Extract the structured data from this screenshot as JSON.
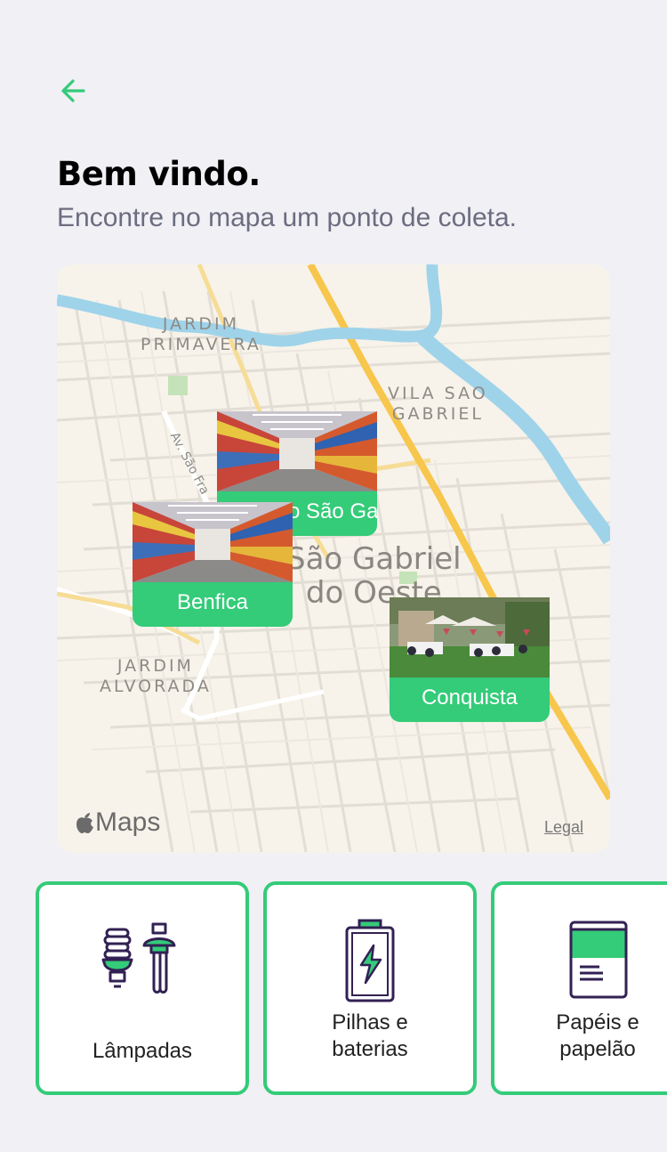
{
  "header": {
    "back_icon": "arrow-left-icon",
    "title": "Bem vindo.",
    "subtitle": "Encontre no mapa um ponto de coleta."
  },
  "map": {
    "neighborhoods": [
      {
        "line1": "JARDIM",
        "line2": "PRIMAVERA"
      },
      {
        "line1": "VILA SAO",
        "line2": "GABRIEL"
      },
      {
        "line1": "JARDIM",
        "line2": "ALVORADA"
      }
    ],
    "city": {
      "line1": "São Gabriel",
      "line2": "do Oeste"
    },
    "street": "Av. São Fra",
    "attribution": "Maps",
    "legal": "Legal",
    "markers": [
      {
        "name": "Mercado São Gabriel",
        "label": "Mercado São Ga"
      },
      {
        "name": "Benfica",
        "label": "Benfica"
      },
      {
        "name": "Conquista",
        "label": "Conquista"
      }
    ]
  },
  "items": [
    {
      "icon": "lamp-icon",
      "label_line1": "Lâmpadas",
      "label_line2": ""
    },
    {
      "icon": "battery-icon",
      "label_line1": "Pilhas e",
      "label_line2": "baterias"
    },
    {
      "icon": "paper-icon",
      "label_line1": "Papéis e",
      "label_line2": "papelão"
    }
  ],
  "colors": {
    "accent": "#34cb79",
    "background": "#f0f0f5",
    "title": "#000000",
    "subtitle": "#6c6c80",
    "icon_stroke": "#322153"
  }
}
